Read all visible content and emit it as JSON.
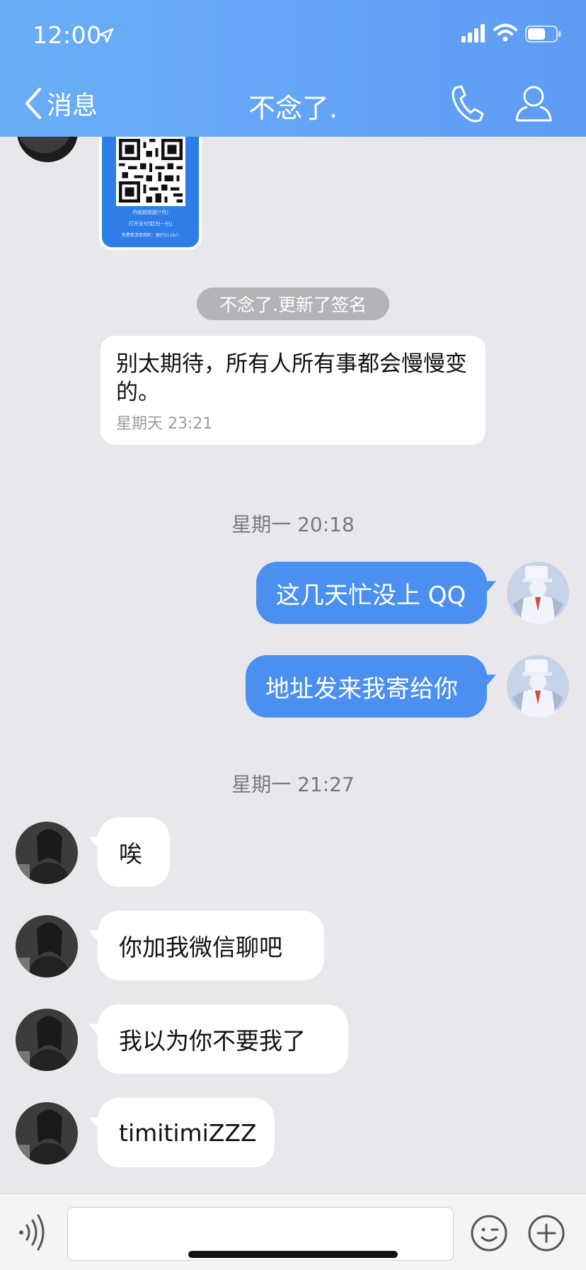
{
  "status_bar": {
    "time": "12:00",
    "icons": [
      "location-arrow-icon",
      "signal-icon",
      "wifi-icon",
      "battery-icon"
    ]
  },
  "header": {
    "back_label": "消息",
    "title": "不念了.",
    "icons": [
      "chevron-left-icon",
      "phone-icon",
      "profile-icon"
    ],
    "color": "#5d9cf3"
  },
  "chat": {
    "qr_card": {
      "name_text": "丹妮妮妮妮(*丹)",
      "hint_text": "打开支付宝[扫一扫]",
      "footer_text": "免费事请使用码：随打5118八"
    },
    "system_notice": "不念了.更新了签名",
    "signature_card": {
      "text": "别太期待，所有人所有事都会慢慢变的。",
      "time": "星期天 23:21"
    },
    "divider_1": "星期一 20:18",
    "outgoing": [
      {
        "text": "这几天忙没上 QQ"
      },
      {
        "text": "地址发来我寄给你"
      }
    ],
    "divider_2": "星期一 21:27",
    "incoming": [
      {
        "text": "唉"
      },
      {
        "text": "你加我微信聊吧"
      },
      {
        "text": "我以为你不要我了"
      },
      {
        "text": "timitimiZZZ"
      }
    ],
    "colors": {
      "outgoing_bubble": "#4b8ff0",
      "incoming_bubble": "#ffffff",
      "background": "#e8e8ec"
    }
  },
  "input_bar": {
    "value": "",
    "placeholder": "",
    "icons": [
      "voice-icon",
      "emoji-icon",
      "plus-icon"
    ]
  }
}
